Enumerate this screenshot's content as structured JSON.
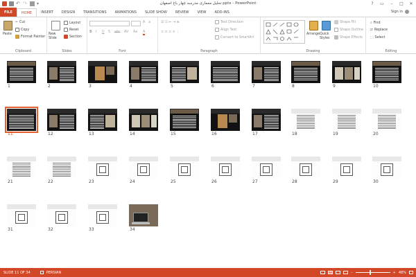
{
  "window": {
    "title": "تحلیل معماری مدرسه چهار باغ اصفهان.pptx - PowerPoint",
    "controls": [
      "?",
      "▭",
      "–",
      "□",
      "✕"
    ]
  },
  "tabs": [
    "FILE",
    "HOME",
    "INSERT",
    "DESIGN",
    "TRANSITIONS",
    "ANIMATIONS",
    "SLIDE SHOW",
    "REVIEW",
    "VIEW",
    "ADD-INS"
  ],
  "active_tab": "HOME",
  "sign_in": "Sign in",
  "ribbon": {
    "clipboard": {
      "label": "Clipboard",
      "paste": "Paste",
      "cut": "Cut",
      "copy": "Copy",
      "format_painter": "Format Painter"
    },
    "slides": {
      "label": "Slides",
      "new_slide": "New Slide",
      "layout": "Layout",
      "reset": "Reset",
      "section": "Section"
    },
    "font": {
      "label": "Font",
      "font_name": "",
      "font_size": "",
      "buttons": [
        "B",
        "I",
        "U",
        "S",
        "abc",
        "AV",
        "Aa"
      ]
    },
    "paragraph": {
      "label": "Paragraph",
      "text_direction": "Text Direction",
      "align_text": "Align Text",
      "convert_smartart": "Convert to SmartArt"
    },
    "drawing": {
      "label": "Drawing",
      "arrange": "Arrange",
      "quick_styles": "Quick Styles",
      "shape_fill": "Shape Fill",
      "shape_outline": "Shape Outline",
      "shape_effects": "Shape Effects"
    },
    "editing": {
      "label": "Editing",
      "find": "Find",
      "replace": "Replace",
      "select": "Select"
    }
  },
  "slides": [
    {
      "n": "1",
      "kind": "dark-photo"
    },
    {
      "n": "2",
      "kind": "dark-text-pic"
    },
    {
      "n": "3",
      "kind": "dark-photo2"
    },
    {
      "n": "4",
      "kind": "dark-text-pic"
    },
    {
      "n": "5",
      "kind": "dark-text-pic2"
    },
    {
      "n": "6",
      "kind": "dark-text"
    },
    {
      "n": "7",
      "kind": "dark-text-pic"
    },
    {
      "n": "8",
      "kind": "dark-photo"
    },
    {
      "n": "9",
      "kind": "dark-photo3"
    },
    {
      "n": "10",
      "kind": "dark-photo"
    },
    {
      "n": "11",
      "kind": "dark-text",
      "selected": true
    },
    {
      "n": "12",
      "kind": "dark-text-pic"
    },
    {
      "n": "13",
      "kind": "dark-text-pic2"
    },
    {
      "n": "14",
      "kind": "dark-photo3"
    },
    {
      "n": "15",
      "kind": "dark-photo"
    },
    {
      "n": "16",
      "kind": "dark-photo2"
    },
    {
      "n": "17",
      "kind": "dark-text-pic"
    },
    {
      "n": "18",
      "kind": "white-text"
    },
    {
      "n": "19",
      "kind": "white-text"
    },
    {
      "n": "20",
      "kind": "white-text"
    },
    {
      "n": "21",
      "kind": "white-text"
    },
    {
      "n": "22",
      "kind": "white-text"
    },
    {
      "n": "23",
      "kind": "white-plan"
    },
    {
      "n": "24",
      "kind": "white-plan"
    },
    {
      "n": "25",
      "kind": "white-plan"
    },
    {
      "n": "26",
      "kind": "white-plan"
    },
    {
      "n": "27",
      "kind": "white-plan"
    },
    {
      "n": "28",
      "kind": "white-plan"
    },
    {
      "n": "29",
      "kind": "white-plan"
    },
    {
      "n": "30",
      "kind": "white-plan"
    },
    {
      "n": "31",
      "kind": "white-plan"
    },
    {
      "n": "32",
      "kind": "white-plan"
    },
    {
      "n": "33",
      "kind": "white-plan"
    },
    {
      "n": "34",
      "kind": "photo-laptop"
    }
  ],
  "status": {
    "slide_info": "SLIDE 11 OF 34",
    "language": "PERSIAN",
    "zoom": "48%"
  },
  "colors": {
    "accent": "#d24726",
    "selection": "#e4602e"
  }
}
